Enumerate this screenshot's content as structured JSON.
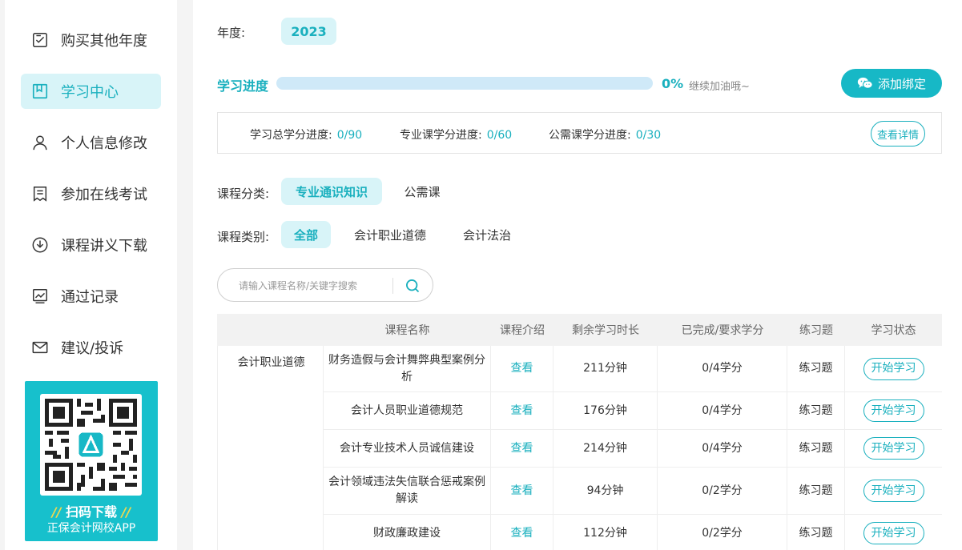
{
  "sidebar": {
    "items": [
      {
        "label": "购买其他年度",
        "icon": "checklist-icon",
        "active": false
      },
      {
        "label": "学习中心",
        "icon": "bookmark-book-icon",
        "active": true
      },
      {
        "label": "个人信息修改",
        "icon": "user-icon",
        "active": false
      },
      {
        "label": "参加在线考试",
        "icon": "exam-paper-icon",
        "active": false
      },
      {
        "label": "课程讲义下载",
        "icon": "download-icon",
        "active": false
      },
      {
        "label": "通过记录",
        "icon": "chart-record-icon",
        "active": false
      },
      {
        "label": "建议/投诉",
        "icon": "mail-icon",
        "active": false
      }
    ],
    "qr": {
      "title": "扫码下载",
      "subtitle": "正保会计网校APP"
    }
  },
  "main": {
    "year": {
      "label": "年度:",
      "value": "2023"
    },
    "progress": {
      "label": "学习进度",
      "percent_text": "0%",
      "percent": 0,
      "hint": "继续加油哦~"
    },
    "bind_button": "添加绑定",
    "credits": {
      "total": {
        "label": "学习总学分进度:",
        "value": "0/90"
      },
      "major": {
        "label": "专业课学分进度:",
        "value": "0/60"
      },
      "public": {
        "label": "公需课学分进度:",
        "value": "0/30"
      },
      "detail_button": "查看详情"
    },
    "course_category": {
      "label": "课程分类:",
      "options": [
        "专业通识知识",
        "公需课"
      ],
      "selected": 0
    },
    "course_type": {
      "label": "课程类别:",
      "options": [
        "全部",
        "会计职业道德",
        "会计法治"
      ],
      "selected": 0
    },
    "search": {
      "placeholder": "请输入课程名称/关键字搜索",
      "value": ""
    },
    "table": {
      "headers": [
        "课程名称",
        "课程介绍",
        "剩余学习时长",
        "已完成/要求学分",
        "练习题",
        "学习状态"
      ],
      "category": "会计职业道德",
      "rows": [
        {
          "name": "财务造假与会计舞弊典型案例分析",
          "intro": "查看",
          "remaining": "211分钟",
          "credits": "0/4学分",
          "exercise": "练习题",
          "action": "开始学习"
        },
        {
          "name": "会计人员职业道德规范",
          "intro": "查看",
          "remaining": "176分钟",
          "credits": "0/4学分",
          "exercise": "练习题",
          "action": "开始学习"
        },
        {
          "name": "会计专业技术人员诚信建设",
          "intro": "查看",
          "remaining": "214分钟",
          "credits": "0/4学分",
          "exercise": "练习题",
          "action": "开始学习"
        },
        {
          "name": "会计领域违法失信联合惩戒案例解读",
          "intro": "查看",
          "remaining": "94分钟",
          "credits": "0/2学分",
          "exercise": "练习题",
          "action": "开始学习"
        },
        {
          "name": "财政廉政建设",
          "intro": "查看",
          "remaining": "112分钟",
          "credits": "0/2学分",
          "exercise": "练习题",
          "action": "开始学习"
        }
      ]
    }
  },
  "colors": {
    "accent": "#1ab0be",
    "accent_light": "#d8f4f8",
    "progress_track": "#cfe9f8",
    "qr_card": "#17c0cc"
  }
}
